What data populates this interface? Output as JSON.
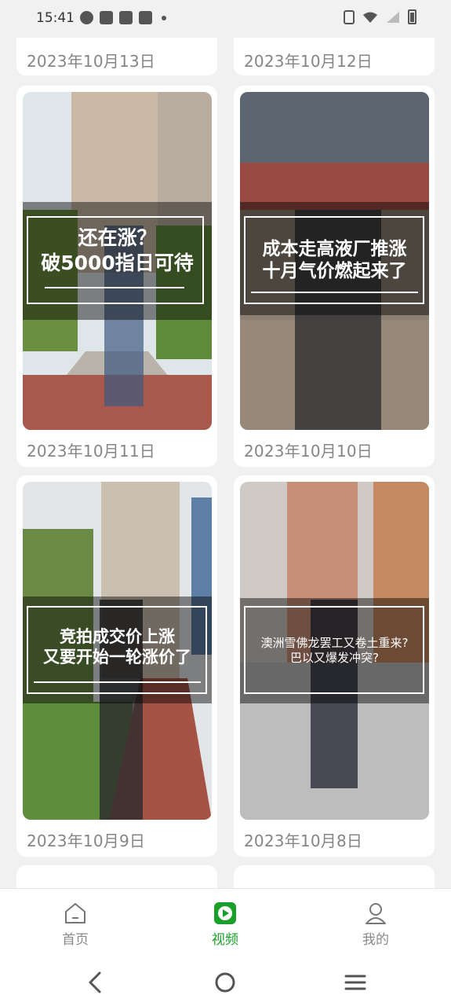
{
  "status_bar": {
    "time": "15:41",
    "left_icons": [
      "speedometer-icon",
      "mail-icon",
      "mail-icon",
      "mail-icon",
      "dot-icon"
    ],
    "right_icons": [
      "vibrate-icon",
      "wifi-icon",
      "signal-icon",
      "battery-icon"
    ]
  },
  "feed": {
    "partial_top_dates": [
      "2023年10月13日",
      "2023年10月12日"
    ],
    "cards": [
      {
        "date": "2023年10月11日",
        "caption": "还在涨？\n破5000指日可待"
      },
      {
        "date": "2023年10月10日",
        "caption": "成本走高液厂推涨\n十月气价燃起来了"
      },
      {
        "date": "2023年10月9日",
        "caption": "竞拍成交价上涨\n又要开始一轮涨价了"
      },
      {
        "date": "2023年10月8日",
        "caption": "澳洲雪佛龙罢工又卷土重来?\n巴以又爆发冲突?"
      }
    ]
  },
  "bottom_nav": {
    "items": [
      {
        "label": "首页",
        "icon": "home-icon"
      },
      {
        "label": "视频",
        "icon": "video-play-icon"
      },
      {
        "label": "我的",
        "icon": "user-icon"
      }
    ],
    "active_color": "#1aa02a"
  },
  "system_nav": {
    "icons": [
      "back-icon",
      "home-circle-icon",
      "menu-icon"
    ]
  }
}
